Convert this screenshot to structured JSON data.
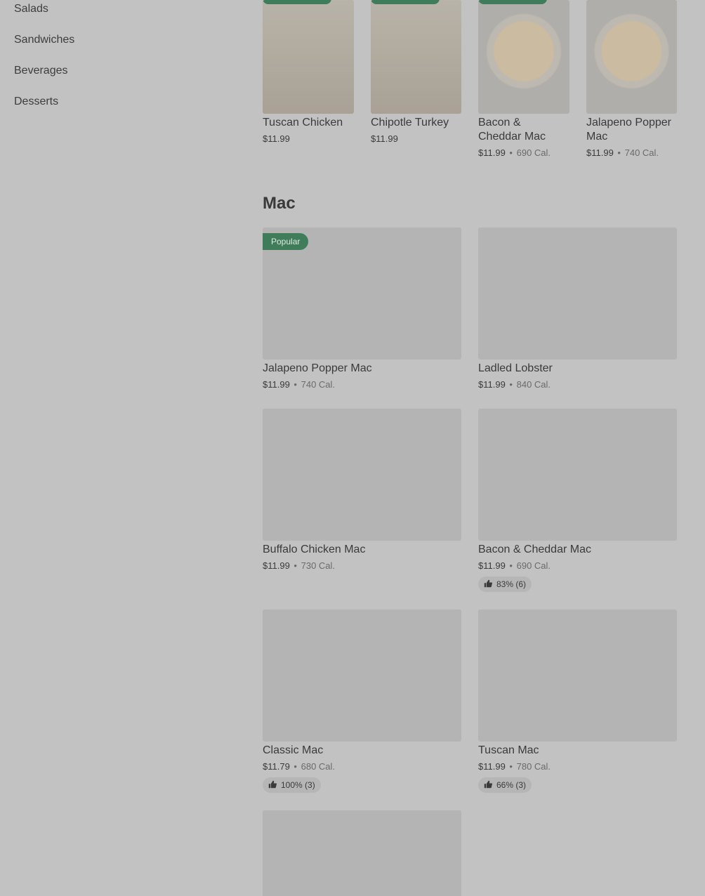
{
  "sidebar": {
    "categories": [
      "Salads",
      "Sandwiches",
      "Beverages",
      "Desserts"
    ]
  },
  "top_row": [
    {
      "name": "Tuscan Chicken",
      "price": "$11.99"
    },
    {
      "name": "Chipotle Turkey",
      "price": "$11.99"
    },
    {
      "name_line1": "Bacon &",
      "name_line2": "Cheddar Mac",
      "price": "$11.99",
      "calories": "690 Cal."
    },
    {
      "name_line1": "Jalapeno Popper",
      "name_line2": "Mac",
      "price": "$11.99",
      "calories": "740 Cal."
    }
  ],
  "section": {
    "title": "Mac"
  },
  "mac_items": [
    {
      "name": "Jalapeno Popper Mac",
      "price": "$11.99",
      "calories": "740 Cal.",
      "badge": "Popular"
    },
    {
      "name": "Ladled Lobster",
      "price": "$11.99",
      "calories": "840 Cal."
    },
    {
      "name": "Buffalo Chicken Mac",
      "price": "$11.99",
      "calories": "730 Cal."
    },
    {
      "name": "Bacon & Cheddar Mac",
      "price": "$11.99",
      "calories": "690 Cal.",
      "rating": "83% (6)"
    },
    {
      "name": "Classic Mac",
      "price": "$11.79",
      "calories": "680 Cal.",
      "rating": "100% (3)"
    },
    {
      "name": "Tuscan Mac",
      "price": "$11.99",
      "calories": "780 Cal.",
      "rating": "66% (3)"
    }
  ],
  "separator": "•",
  "icons": {
    "rating": "thumbs-up-icon"
  },
  "colors": {
    "badge": "#3f7d5a",
    "overlay": "#c2c2c2"
  }
}
